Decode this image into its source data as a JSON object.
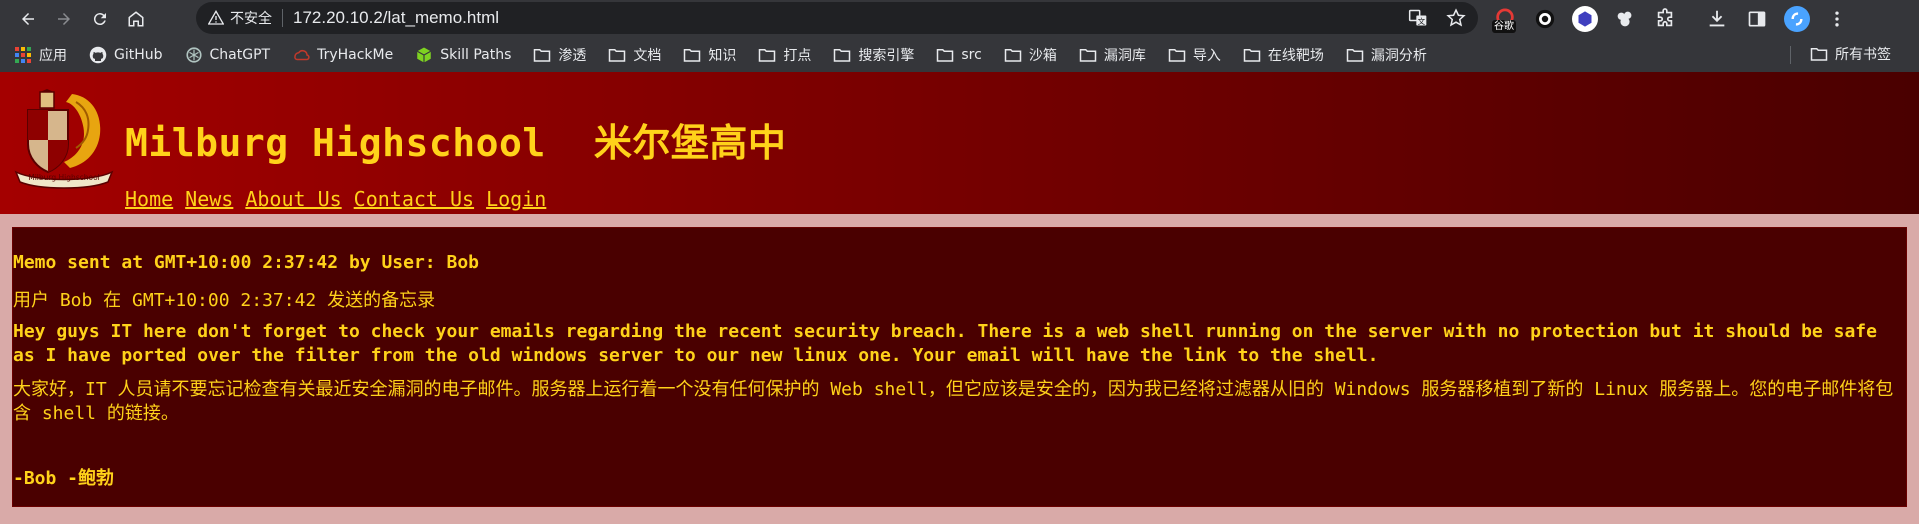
{
  "browser": {
    "security_label": "不安全",
    "url": "172.20.10.2/lat_memo.html",
    "extension_badge": "谷歌",
    "bookmarks": [
      {
        "label": "应用",
        "icon": "apps-grid-icon"
      },
      {
        "label": "GitHub",
        "icon": "github-icon"
      },
      {
        "label": "ChatGPT",
        "icon": "chatgpt-icon"
      },
      {
        "label": "TryHackMe",
        "icon": "tryhackme-icon"
      },
      {
        "label": "Skill Paths",
        "icon": "cube-icon"
      },
      {
        "label": "渗透",
        "icon": "folder-icon"
      },
      {
        "label": "文档",
        "icon": "folder-icon"
      },
      {
        "label": "知识",
        "icon": "folder-icon"
      },
      {
        "label": "打点",
        "icon": "folder-icon"
      },
      {
        "label": "搜索引擎",
        "icon": "folder-icon"
      },
      {
        "label": "src",
        "icon": "folder-icon"
      },
      {
        "label": "沙箱",
        "icon": "folder-icon"
      },
      {
        "label": "漏洞库",
        "icon": "folder-icon"
      },
      {
        "label": "导入",
        "icon": "folder-icon"
      },
      {
        "label": "在线靶场",
        "icon": "folder-icon"
      },
      {
        "label": "漏洞分析",
        "icon": "folder-icon"
      }
    ],
    "all_bookmarks_label": "所有书签"
  },
  "site": {
    "title_en": "Milburg Highschool",
    "title_cn": "米尔堡高中",
    "nav": [
      "Home",
      "News",
      "About Us",
      "Contact Us",
      "Login"
    ],
    "logo_text": "Milburg Highschool"
  },
  "memo": {
    "header_en": "Memo sent at GMT+10:00 2:37:42 by User: Bob",
    "header_cn": "用户 Bob 在 GMT+10:00 2:37:42 发送的备忘录",
    "body_en": "Hey guys IT here don't forget to check your emails regarding the recent security breach. There is a web shell running on the server with no protection but it should be safe as I have ported over the filter from the old windows server to our new linux one. Your email will have the link to the shell.",
    "body_cn": "大家好，IT 人员请不要忘记检查有关最近安全漏洞的电子邮件。服务器上运行着一个没有任何保护的 Web shell，但它应该是安全的，因为我已经将过滤器从旧的 Windows 服务器移植到了新的 Linux 服务器上。您的电子邮件将包含 shell 的链接。",
    "signature": "-Bob  -鲍勃"
  },
  "colors": {
    "accent_yellow": "#ffd21a",
    "header_red": "#a40000",
    "memo_bg": "#4a0000",
    "page_bg": "#d9aaa8"
  }
}
